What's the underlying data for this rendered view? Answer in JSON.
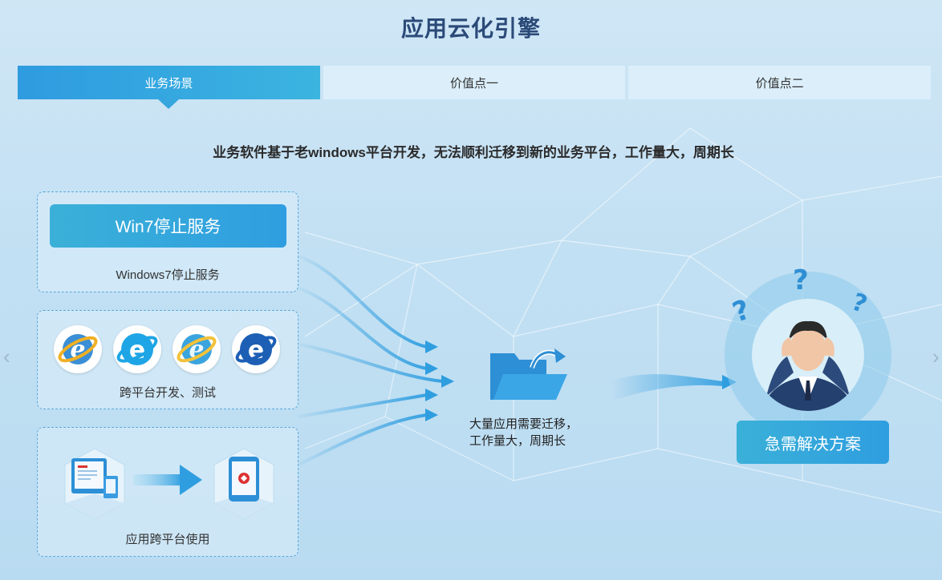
{
  "page": {
    "title": "应用云化引擎"
  },
  "tabs": [
    {
      "label": "业务场景",
      "active": true
    },
    {
      "label": "价值点一",
      "active": false
    },
    {
      "label": "价值点二",
      "active": false
    }
  ],
  "scene": {
    "subtitle": "业务软件基于老windows平台开发，无法顺利迁移到新的业务平台，工作量大，周期长",
    "box1": {
      "button_label": "Win7停止服务",
      "caption": "Windows7停止服务"
    },
    "box2": {
      "caption": "跨平台开发、测试",
      "icons": [
        "ie-classic-icon",
        "ie-blue-icon",
        "ie-classic-icon",
        "ie-edge-dark-icon"
      ]
    },
    "box3": {
      "caption": "应用跨平台使用"
    },
    "middle": {
      "caption_line1": "大量应用需要迁移，",
      "caption_line2": "工作量大，周期长"
    },
    "solution_button": "急需解决方案"
  },
  "colors": {
    "accent": "#2f9ee0",
    "title": "#2b4a78",
    "tab_inactive": "#dbeefa"
  }
}
